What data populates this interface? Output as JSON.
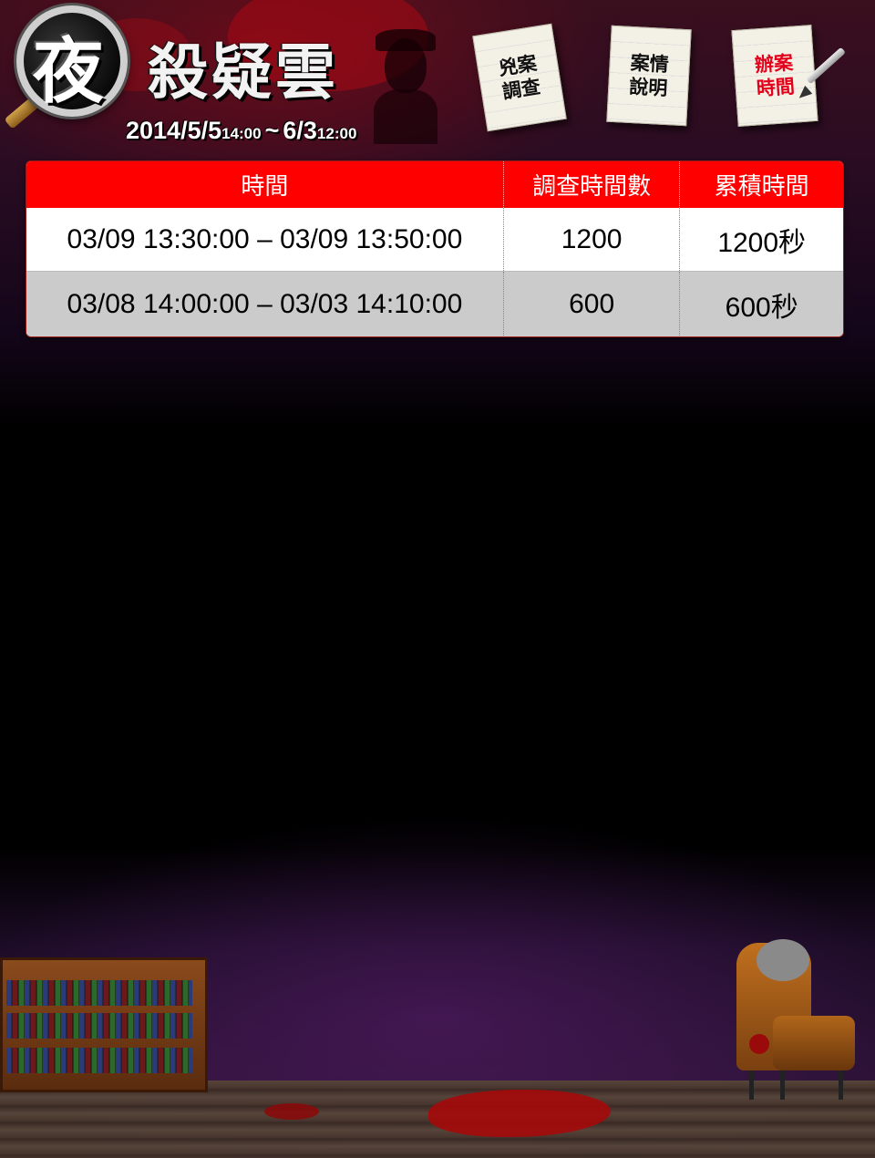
{
  "header": {
    "title_first_char": "夜",
    "title_rest": "殺疑雲",
    "date_start": "2014/5/5",
    "date_start_time": "14:00",
    "date_separator": "~",
    "date_end": "6/3",
    "date_end_time": "12:00"
  },
  "nav": {
    "items": [
      {
        "label": "兇案調查",
        "active": false
      },
      {
        "label": "案情說明",
        "active": false
      },
      {
        "label": "辦案時間",
        "active": true
      }
    ]
  },
  "table": {
    "headers": [
      "時間",
      "調查時間數",
      "累積時間"
    ],
    "rows": [
      {
        "time": "03/09 13:30:00 – 03/09 13:50:00",
        "count": "1200",
        "accum": "1200秒"
      },
      {
        "time": "03/08 14:00:00 – 03/03 14:10:00",
        "count": "600",
        "accum": "600秒"
      }
    ]
  },
  "colors": {
    "header_red": "#ff0000",
    "active_nav_text": "#e3001b",
    "row_even": "#ffffff",
    "row_odd": "#cbcbcb"
  },
  "icons": [
    "magnifier-icon",
    "detective-silhouette-icon",
    "pen-icon",
    "bookshelf-icon",
    "armchair-icon",
    "blood-splat-icon"
  ]
}
